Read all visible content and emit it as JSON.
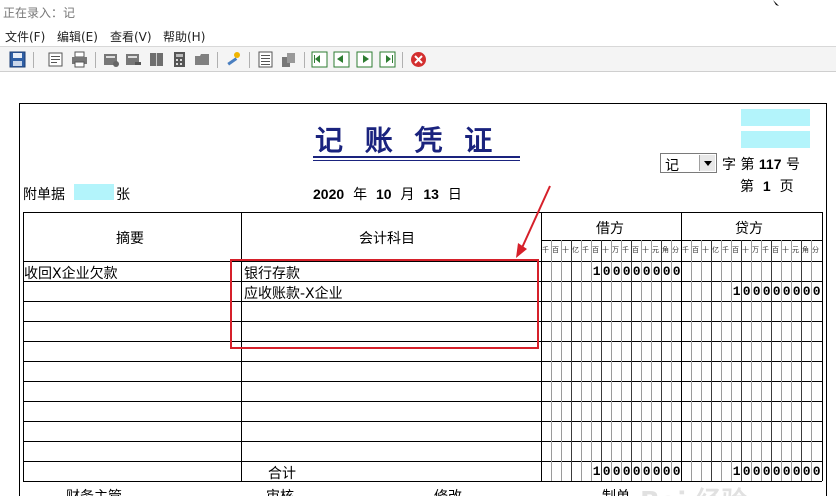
{
  "window": {
    "title": "正在录入：记"
  },
  "menu": [
    {
      "label": "文件(F)"
    },
    {
      "label": "编辑(E)"
    },
    {
      "label": "查看(V)"
    },
    {
      "label": "帮助(H)"
    }
  ],
  "toolbar": {
    "icons": [
      "save-icon",
      "preview-icon",
      "print-icon",
      "insert-row-icon",
      "delete-row-icon",
      "book-icon",
      "calculator-icon",
      "folder-icon",
      "wizard-icon",
      "list-icon",
      "paste-icon",
      "first-icon",
      "prev-icon",
      "next-icon",
      "last-icon",
      "close-icon"
    ]
  },
  "voucher": {
    "title": "记 账 凭 证",
    "type_label": "字",
    "type_value": "记",
    "number_prefix": "第",
    "number": "117",
    "number_suffix": "号",
    "page_prefix": "第",
    "page": "1",
    "page_suffix": "页",
    "attachment_prefix": "附单据",
    "attachment_suffix": "张",
    "date": {
      "year": "2020",
      "year_label": "年",
      "month": "10",
      "month_label": "月",
      "day": "13",
      "day_label": "日"
    },
    "columns": {
      "summary": "摘要",
      "account": "会计科目",
      "debit": "借方",
      "credit": "贷方"
    },
    "digit_labels": [
      "千",
      "百",
      "十",
      "亿",
      "千",
      "百",
      "十",
      "万",
      "千",
      "百",
      "十",
      "元",
      "角",
      "分"
    ],
    "rows": [
      {
        "summary": "收回X企业欠款",
        "account": "银行存款",
        "debit": "100000000",
        "credit": ""
      },
      {
        "summary": "",
        "account": "应收账款-X企业",
        "debit": "",
        "credit": "100000000"
      },
      {
        "summary": "",
        "account": "",
        "debit": "",
        "credit": ""
      },
      {
        "summary": "",
        "account": "",
        "debit": "",
        "credit": ""
      },
      {
        "summary": "",
        "account": "",
        "debit": "",
        "credit": ""
      },
      {
        "summary": "",
        "account": "",
        "debit": "",
        "credit": ""
      },
      {
        "summary": "",
        "account": "",
        "debit": "",
        "credit": ""
      },
      {
        "summary": "",
        "account": "",
        "debit": "",
        "credit": ""
      },
      {
        "summary": "",
        "account": "",
        "debit": "",
        "credit": ""
      },
      {
        "summary": "",
        "account": "",
        "debit": "",
        "credit": ""
      }
    ],
    "total": {
      "label": "合计",
      "debit": "100000000",
      "credit": "100000000"
    },
    "footer": [
      "财务主管",
      "审核",
      "修改",
      "制单"
    ]
  },
  "watermark": "Bai 经验",
  "colors": {
    "title": "#1a237e",
    "highlight": "#d6202a",
    "cyan": "#b3f4fb"
  }
}
